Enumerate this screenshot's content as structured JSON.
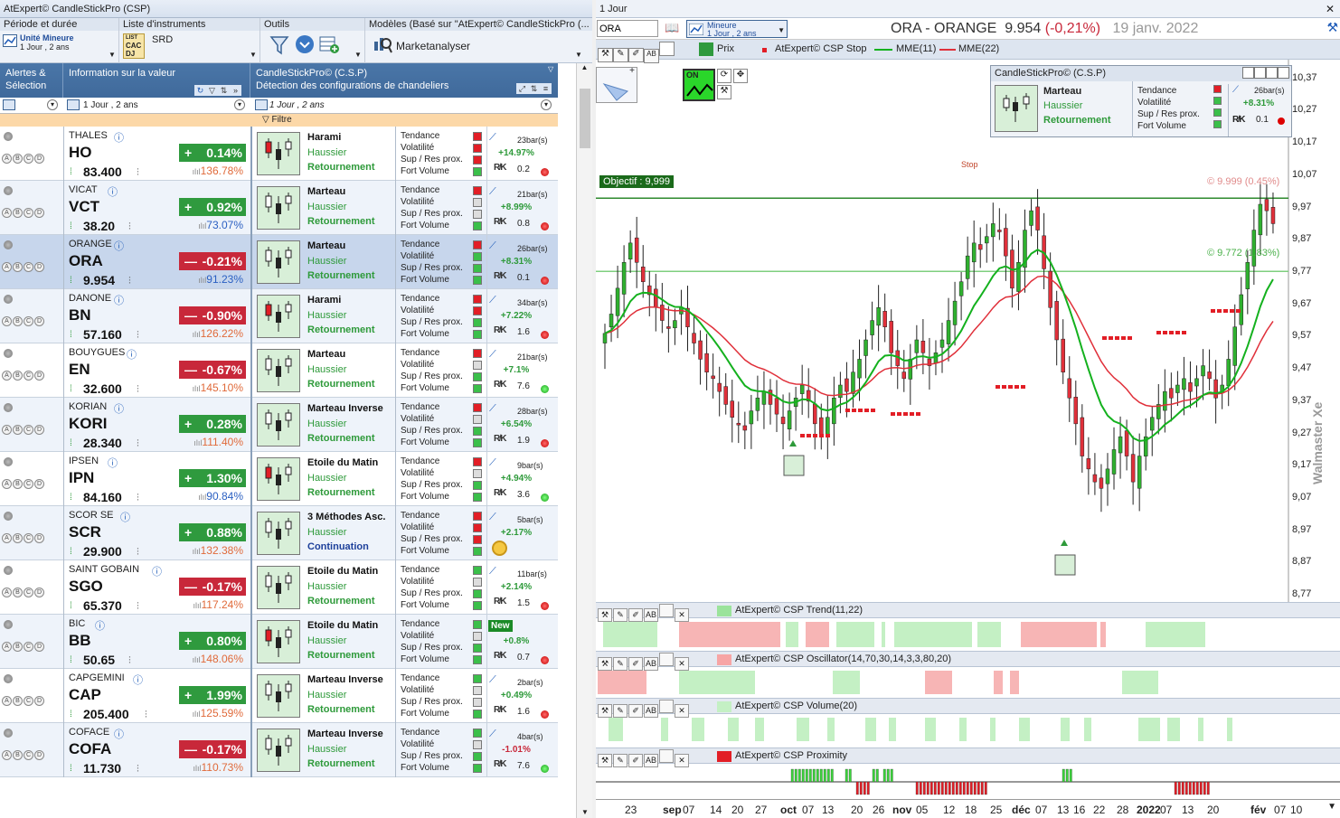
{
  "left_window": {
    "title": "AtExpert© CandleStickPro (CSP)",
    "toolbar": {
      "period_header": "Période et durée",
      "period_unit": "Unité Mineure",
      "period_value": "1 Jour , 2 ans",
      "instruments_header": "Liste d'instruments",
      "list_items": [
        "CAC",
        "DJ"
      ],
      "list_extra": "SRD",
      "tools_header": "Outils",
      "models_header": "Modèles (Basé sur \"AtExpert© CandleStickPro (...",
      "models_button": "Marketanalyser"
    },
    "grid_header": {
      "col1": "Alertes &\nSélection",
      "col2": "Information sur la valeur",
      "col3_line1": "CandleStickPro© (C.S.P)",
      "col3_line2": "Détection des configurations de chandeliers",
      "sub_period": "1 Jour , 2 ans",
      "sub_period2": "1 Jour , 2 ans",
      "filter_label": "Filtre"
    },
    "indicator_labels": [
      "Tendance",
      "Volatilité",
      "Sup / Res prox.",
      "Fort Volume"
    ],
    "rows": [
      {
        "name": "THALES",
        "ticker": "HO",
        "price": "83.400",
        "change": "0.14%",
        "dir": "up",
        "vol": "136.78%",
        "volc": "pink",
        "pattern": "Harami",
        "trend": "Haussier",
        "type": "Retournement",
        "sq": [
          "r",
          "r",
          "r",
          "g"
        ],
        "bars": "23bar(s)",
        "pct": "+14.97%",
        "pdir": "up",
        "rr": "0.2",
        "rdot": "r"
      },
      {
        "name": "VICAT",
        "ticker": "VCT",
        "price": "38.20",
        "change": "0.92%",
        "dir": "up",
        "vol": "73.07%",
        "volc": "blue",
        "pattern": "Marteau",
        "trend": "Haussier",
        "type": "Retournement",
        "sq": [
          "r",
          "w",
          "w",
          "g"
        ],
        "bars": "21bar(s)",
        "pct": "+8.99%",
        "pdir": "up",
        "rr": "0.8",
        "rdot": "r"
      },
      {
        "name": "ORANGE",
        "ticker": "ORA",
        "price": "9.954",
        "change": "-0.21%",
        "dir": "dn",
        "vol": "91.23%",
        "volc": "blue",
        "pattern": "Marteau",
        "trend": "Haussier",
        "type": "Retournement",
        "sq": [
          "r",
          "g",
          "g",
          "g"
        ],
        "bars": "26bar(s)",
        "pct": "+8.31%",
        "pdir": "up",
        "rr": "0.1",
        "rdot": "r"
      },
      {
        "name": "DANONE",
        "ticker": "BN",
        "price": "57.160",
        "change": "-0.90%",
        "dir": "dn",
        "vol": "126.22%",
        "volc": "pink",
        "pattern": "Harami",
        "trend": "Haussier",
        "type": "Retournement",
        "sq": [
          "r",
          "r",
          "g",
          "g"
        ],
        "bars": "34bar(s)",
        "pct": "+7.22%",
        "pdir": "up",
        "rr": "1.6",
        "rdot": "r"
      },
      {
        "name": "BOUYGUES",
        "ticker": "EN",
        "price": "32.600",
        "change": "-0.67%",
        "dir": "dn",
        "vol": "145.10%",
        "volc": "pink",
        "pattern": "Marteau",
        "trend": "Haussier",
        "type": "Retournement",
        "sq": [
          "r",
          "w",
          "g",
          "g"
        ],
        "bars": "21bar(s)",
        "pct": "+7.1%",
        "pdir": "up",
        "rr": "7.6",
        "rdot": "g"
      },
      {
        "name": "KORIAN",
        "ticker": "KORI",
        "price": "28.340",
        "change": "0.28%",
        "dir": "up",
        "vol": "111.40%",
        "volc": "pink",
        "pattern": "Marteau Inverse",
        "trend": "Haussier",
        "type": "Retournement",
        "sq": [
          "r",
          "w",
          "g",
          "g"
        ],
        "bars": "28bar(s)",
        "pct": "+6.54%",
        "pdir": "up",
        "rr": "1.9",
        "rdot": "r"
      },
      {
        "name": "IPSEN",
        "ticker": "IPN",
        "price": "84.160",
        "change": "1.30%",
        "dir": "up",
        "vol": "90.84%",
        "volc": "blue",
        "pattern": "Etoile du Matin",
        "trend": "Haussier",
        "type": "Retournement",
        "sq": [
          "r",
          "w",
          "g",
          "g"
        ],
        "bars": "9bar(s)",
        "pct": "+4.94%",
        "pdir": "up",
        "rr": "3.6",
        "rdot": "g"
      },
      {
        "name": "SCOR SE",
        "ticker": "SCR",
        "price": "29.900",
        "change": "0.88%",
        "dir": "up",
        "vol": "132.38%",
        "volc": "pink",
        "pattern": "3 Méthodes Asc.",
        "trend": "Haussier",
        "type": "Continuation",
        "sq": [
          "r",
          "r",
          "r",
          "g"
        ],
        "bars": "5bar(s)",
        "pct": "+2.17%",
        "pdir": "up",
        "rr": "",
        "rdot": "target"
      },
      {
        "name": "SAINT GOBAIN",
        "ticker": "SGO",
        "price": "65.370",
        "change": "-0.17%",
        "dir": "dn",
        "vol": "117.24%",
        "volc": "pink",
        "pattern": "Etoile du Matin",
        "trend": "Haussier",
        "type": "Retournement",
        "sq": [
          "g",
          "w",
          "g",
          "g"
        ],
        "bars": "11bar(s)",
        "pct": "+2.14%",
        "pdir": "up",
        "rr": "1.5",
        "rdot": "r"
      },
      {
        "name": "BIC",
        "ticker": "BB",
        "price": "50.65",
        "change": "0.80%",
        "dir": "up",
        "vol": "148.06%",
        "volc": "pink",
        "pattern": "Etoile du Matin",
        "trend": "Haussier",
        "type": "Retournement",
        "sq": [
          "g",
          "w",
          "g",
          "g"
        ],
        "bars": "New",
        "pct": "+0.8%",
        "pdir": "up",
        "rr": "0.7",
        "rdot": "r"
      },
      {
        "name": "CAPGEMINI",
        "ticker": "CAP",
        "price": "205.400",
        "change": "1.99%",
        "dir": "up",
        "vol": "125.59%",
        "volc": "pink",
        "pattern": "Marteau Inverse",
        "trend": "Haussier",
        "type": "Retournement",
        "sq": [
          "g",
          "w",
          "w",
          "g"
        ],
        "bars": "2bar(s)",
        "pct": "+0.49%",
        "pdir": "up",
        "rr": "1.6",
        "rdot": "r"
      },
      {
        "name": "COFACE",
        "ticker": "COFA",
        "price": "11.730",
        "change": "-0.17%",
        "dir": "dn",
        "vol": "110.73%",
        "volc": "pink",
        "pattern": "Marteau Inverse",
        "trend": "Haussier",
        "type": "Retournement",
        "sq": [
          "g",
          "w",
          "g",
          "g"
        ],
        "bars": "4bar(s)",
        "pct": "-1.01%",
        "pdir": "dn",
        "rr": "7.6",
        "rdot": "g"
      }
    ]
  },
  "right_window": {
    "title": "1 Jour",
    "symbol_input": "ORA",
    "period_unit": "Mineure",
    "period_value": "1 Jour , 2 ans",
    "instrument_title": "ORA - ORANGE",
    "last_price": "9.954",
    "change": "(-0,21%)",
    "date": "19 janv. 2022",
    "legend": [
      "Prix",
      "AtExpert© CSP Stop",
      "MME(11)",
      "MME(22)"
    ],
    "info_box": {
      "title": "CandleStickPro© (C.S.P)",
      "pattern": "Marteau",
      "trend": "Haussier",
      "type": "Retournement",
      "bars": "26bar(s)",
      "pct": "+8.31%",
      "rr": "0.1"
    },
    "on_label": "ON",
    "objective_label": "Objectif : 9,999",
    "stop_label": "Stop",
    "upper_price_label": "© 9.999 (0.45%)",
    "lower_price_label": "© 9.772 (1.83%)",
    "watermark": "Walmaster Xe",
    "panels": [
      "AtExpert© CSP Trend(11,22)",
      "AtExpert© CSP Oscillator(14,70,30,14,3,3,80,20)",
      "AtExpert© CSP Volume(20)",
      "AtExpert© CSP Proximity"
    ],
    "x_labels": [
      "23",
      "sep",
      "07",
      "14",
      "20",
      "27",
      "oct",
      "07",
      "13",
      "20",
      "26",
      "nov",
      "05",
      "12",
      "18",
      "25",
      "déc",
      "07",
      "13",
      "16",
      "22",
      "28",
      "2022",
      "07",
      "13",
      "20",
      "fév",
      "07",
      "10"
    ]
  },
  "chart_data": {
    "type": "candlestick",
    "y_ticks": [
      "10,37",
      "10,27",
      "10,17",
      "10,07",
      "9,97",
      "9,87",
      "9,77",
      "9,67",
      "9,57",
      "9,47",
      "9,37",
      "9,27",
      "9,17",
      "9,07",
      "8,97",
      "8,87",
      "8,77"
    ],
    "ylim": [
      8.72,
      10.4
    ],
    "objective": 9.999,
    "lower_level": 9.772,
    "close": [
      9.58,
      9.64,
      9.72,
      9.8,
      9.86,
      9.8,
      9.74,
      9.7,
      9.66,
      9.62,
      9.6,
      9.62,
      9.66,
      9.6,
      9.55,
      9.5,
      9.46,
      9.44,
      9.4,
      9.36,
      9.32,
      9.3,
      9.28,
      9.34,
      9.38,
      9.4,
      9.36,
      9.33,
      9.3,
      9.34,
      9.38,
      9.42,
      9.37,
      9.3,
      9.26,
      9.32,
      9.38,
      9.42,
      9.4,
      9.46,
      9.5,
      9.56,
      9.62,
      9.66,
      9.6,
      9.52,
      9.48,
      9.44,
      9.5,
      9.56,
      9.52,
      9.48,
      9.52,
      9.56,
      9.62,
      9.68,
      9.74,
      9.82,
      9.86,
      9.84,
      9.88,
      9.92,
      9.9,
      9.82,
      9.72,
      9.8,
      9.9,
      9.96,
      9.9,
      9.78,
      9.66,
      9.56,
      9.46,
      9.38,
      9.3,
      9.2,
      9.16,
      9.12,
      9.1,
      9.16,
      9.22,
      9.26,
      9.2,
      9.12,
      9.2,
      9.26,
      9.32,
      9.36,
      9.4,
      9.38,
      9.42,
      9.44,
      9.4,
      9.44,
      9.48,
      9.44,
      9.38,
      9.42,
      9.5,
      9.6,
      9.7,
      9.8,
      9.9,
      9.98,
      9.96,
      9.92
    ],
    "ema11": [],
    "ema22": []
  }
}
